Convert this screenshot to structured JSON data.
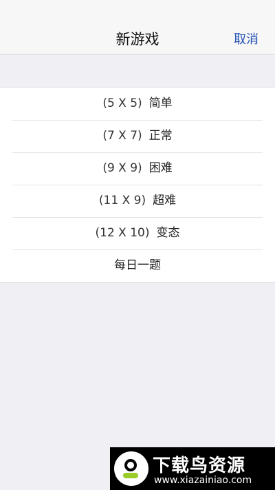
{
  "nav": {
    "title": "新游戏",
    "cancel_label": "取消"
  },
  "options": [
    {
      "size": "(5 X 5)",
      "label": "简单"
    },
    {
      "size": "(7 X 7)",
      "label": "正常"
    },
    {
      "size": "(9 X 9)",
      "label": "困难"
    },
    {
      "size": "(11 X 9)",
      "label": "超难"
    },
    {
      "size": "(12 X 10)",
      "label": "变态"
    },
    {
      "size": "",
      "label": "每日一题"
    }
  ],
  "watermark": {
    "title": "下载鸟资源",
    "url": "www.xiazainiao.com"
  },
  "colors": {
    "accent": "#1f4fb5",
    "background": "#efeff4",
    "logo_green": "#9ccc2a"
  }
}
